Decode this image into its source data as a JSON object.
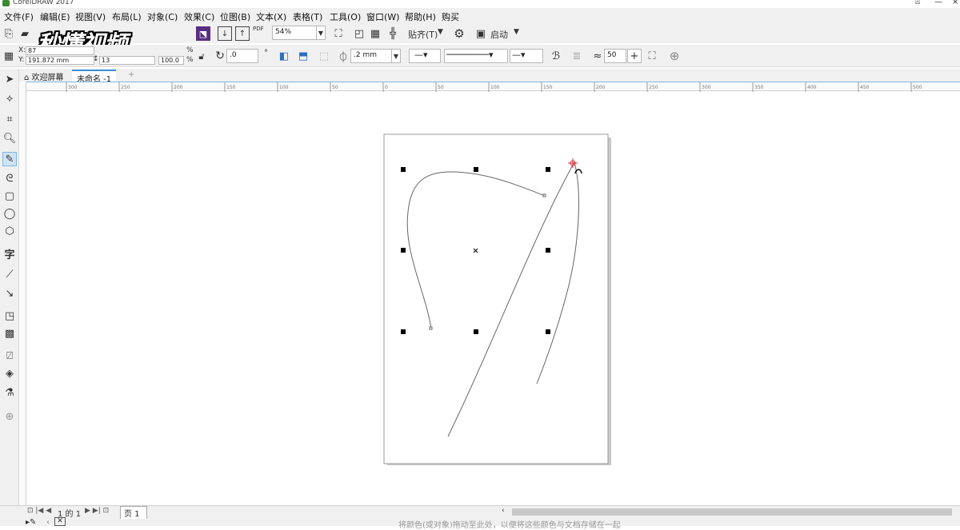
{
  "app": {
    "title": "CorelDRAW 2017"
  },
  "menu": [
    "文件(F)",
    "编辑(E)",
    "视图(V)",
    "布局(L)",
    "对象(C)",
    "效果(C)",
    "位图(B)",
    "文本(X)",
    "表格(T)",
    "工具(O)",
    "窗口(W)",
    "帮助(H)",
    "购买"
  ],
  "watermark": "秒懂视频",
  "toolbar": {
    "pdf_label": "PDF",
    "zoom_value": "54%",
    "snap_label": "贴齐(T)",
    "launch_label": "启动"
  },
  "props": {
    "x_label": "X:",
    "x_value": "87",
    "y_label": "Y:",
    "y_value": "191.872 mm",
    "h_value": "13",
    "scale_value": "100.0",
    "percent": "%",
    "rotate_value": ".0",
    "outline_value": ".2 mm",
    "smooth_value": "50"
  },
  "tabs": {
    "welcome": "欢迎屏幕",
    "doc": "未命名 -1"
  },
  "ruler_labels": [
    "300",
    "250",
    "200",
    "150",
    "100",
    "50",
    "0",
    "50",
    "100",
    "150",
    "200",
    "250",
    "300",
    "350",
    "400",
    "450",
    "500"
  ],
  "page_nav": {
    "page_text": "1 的 1",
    "page_tab": "页 1"
  },
  "status": {
    "hint": "将颜色(或对象)拖动至此处，以便将这些颜色与文档存储在一起"
  }
}
